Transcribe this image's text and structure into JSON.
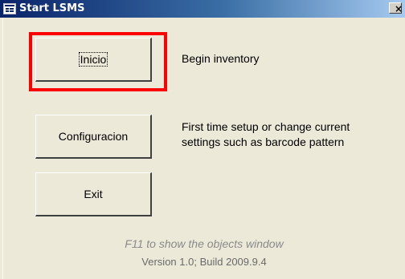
{
  "window": {
    "title": "Start LSMS",
    "close_label": "×"
  },
  "buttons": [
    {
      "label": "Inicio",
      "description": "Begin inventory",
      "focused": true,
      "highlighted": true
    },
    {
      "label": "Configuracion",
      "description_lines": [
        "First time setup or change current",
        "settings such as  barcode pattern"
      ]
    },
    {
      "label": "Exit"
    }
  ],
  "footer": {
    "hint": "F11 to show the objects window",
    "version": "Version 1.0; Build 2009.9.4"
  },
  "colors": {
    "titlebar_start": "#0a246a",
    "titlebar_end": "#a6caf0",
    "background": "#ece9d8",
    "highlight": "#ff0000"
  },
  "icons": {
    "title": "form-window-icon",
    "close": "close-icon"
  }
}
